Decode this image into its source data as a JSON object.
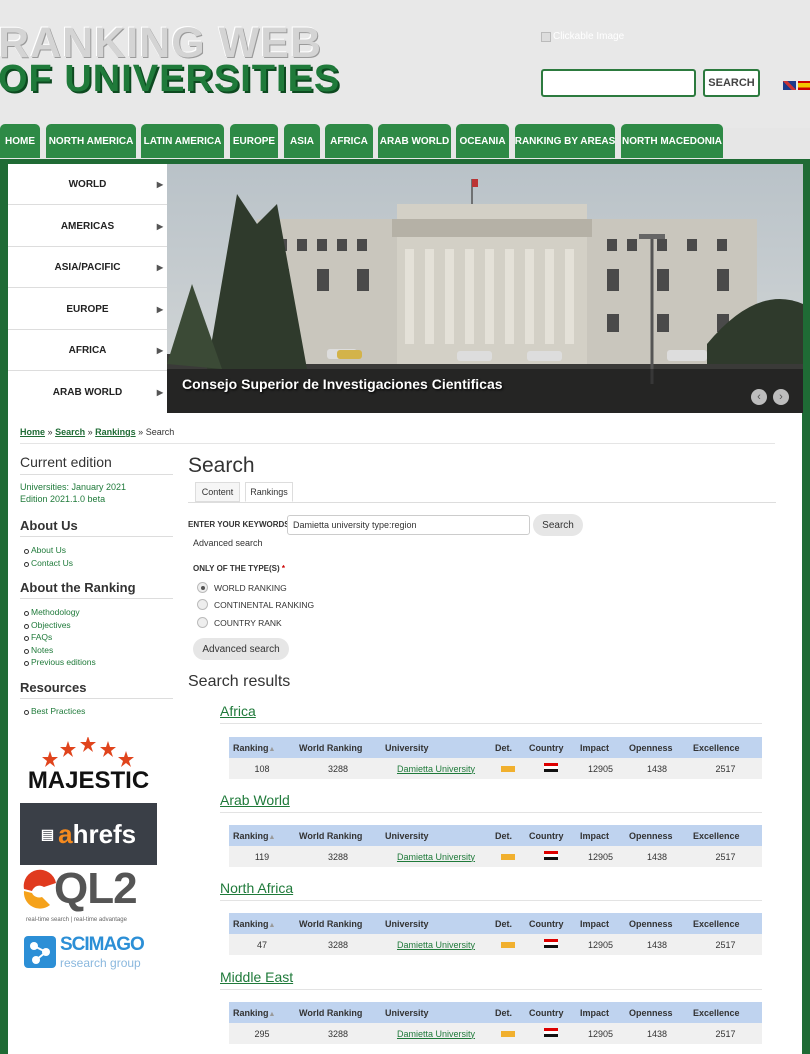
{
  "header": {
    "logo_line1": "RANKING WEB",
    "logo_line2": "OF UNIVERSITIES",
    "clickable_image_alt": "Clickable Image",
    "search_button": "SEARCH",
    "search_value": ""
  },
  "nav": {
    "items": [
      "HOME",
      "NORTH AMERICA",
      "LATIN AMERICA",
      "EUROPE",
      "ASIA",
      "AFRICA",
      "ARAB WORLD",
      "OCEANIA",
      "RANKING BY AREAS",
      "NORTH MACEDONIA"
    ]
  },
  "side_menu": {
    "items": [
      "WORLD",
      "AMERICAS",
      "ASIA/PACIFIC",
      "EUROPE",
      "AFRICA",
      "ARAB WORLD"
    ]
  },
  "slider": {
    "caption": "Consejo Superior de Investigaciones Cientificas"
  },
  "breadcrumb": {
    "home": "Home",
    "search": "Search",
    "rankings": "Rankings",
    "current": "Search",
    "sep": "»"
  },
  "left": {
    "current_edition_title": "Current edition",
    "current_edition_line1": "Universities: January 2021",
    "current_edition_line2": "Edition 2021.1.0 beta",
    "about_us_title": "About Us",
    "about_us_items": [
      "About Us",
      "Contact Us"
    ],
    "about_ranking_title": "About the Ranking",
    "about_ranking_items": [
      "Methodology",
      "Objectives",
      "FAQs",
      "Notes",
      "Previous editions"
    ],
    "resources_title": "Resources",
    "resources_items": [
      "Best Practices"
    ],
    "logos": {
      "majestic": "MAJESTIC",
      "ahrefs_a": "a",
      "ahrefs_rest": "hrefs",
      "ql2": "QL2",
      "ql2_tag": "real-time search | real-time advantage",
      "scimago": "SCIMAGO",
      "scimago_sub": "research group"
    }
  },
  "search": {
    "title": "Search",
    "tabs": [
      "Content",
      "Rankings"
    ],
    "keywords_label": "ENTER YOUR KEYWORDS",
    "keywords_value": "Damietta university type:region",
    "search_button": "Search",
    "advanced_link": "Advanced search",
    "type_label": "ONLY OF THE TYPE(S)",
    "type_required": "*",
    "type_options": [
      "WORLD RANKING",
      "CONTINENTAL RANKING",
      "COUNTRY RANK"
    ],
    "selected_type": "WORLD RANKING",
    "advanced_button": "Advanced search"
  },
  "results": {
    "title": "Search results",
    "columns": [
      "Ranking",
      "World Ranking",
      "University",
      "Det.",
      "Country",
      "Impact",
      "Openness",
      "Excellence"
    ],
    "groups": [
      {
        "name": "Africa",
        "row": {
          "ranking": "108",
          "world": "3288",
          "university": "Damietta University",
          "impact": "12905",
          "openness": "1438",
          "excellence": "2517"
        }
      },
      {
        "name": "Arab World",
        "row": {
          "ranking": "119",
          "world": "3288",
          "university": "Damietta University",
          "impact": "12905",
          "openness": "1438",
          "excellence": "2517"
        }
      },
      {
        "name": "North Africa",
        "row": {
          "ranking": "47",
          "world": "3288",
          "university": "Damietta University",
          "impact": "12905",
          "openness": "1438",
          "excellence": "2517"
        }
      },
      {
        "name": "Middle East",
        "row": {
          "ranking": "295",
          "world": "3288",
          "university": "Damietta University",
          "impact": "12905",
          "openness": "1438",
          "excellence": "2517"
        }
      }
    ]
  },
  "colors": {
    "brand_green": "#1f6b35",
    "nav_green": "#2e8a46",
    "table_header": "#bfd3ef"
  }
}
